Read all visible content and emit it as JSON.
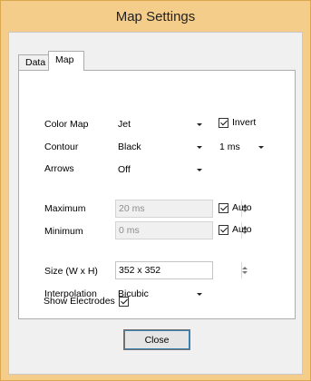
{
  "window": {
    "title": "Map Settings"
  },
  "tabs": [
    {
      "label": "Data",
      "active": false
    },
    {
      "label": "Map",
      "active": true
    }
  ],
  "map": {
    "color_map": {
      "label": "Color Map",
      "value": "Jet"
    },
    "invert": {
      "label": "Invert",
      "checked": true
    },
    "contour": {
      "label": "Contour",
      "value": "Black"
    },
    "contour_interval": {
      "value": "1 ms"
    },
    "arrows": {
      "label": "Arrows",
      "value": "Off"
    },
    "maximum": {
      "label": "Maximum",
      "value": "20 ms",
      "enabled": false
    },
    "maximum_auto": {
      "label": "Auto",
      "checked": true
    },
    "minimum": {
      "label": "Minimum",
      "value": "0 ms",
      "enabled": false
    },
    "minimum_auto": {
      "label": "Auto",
      "checked": true
    },
    "size": {
      "label": "Size (W x H)",
      "value": "352 x 352"
    },
    "interpolation": {
      "label": "Interpolation",
      "value": "Bicubic"
    },
    "show_electrodes": {
      "label": "Show Electrodes",
      "checked": true
    }
  },
  "buttons": {
    "close_label": "Close"
  }
}
